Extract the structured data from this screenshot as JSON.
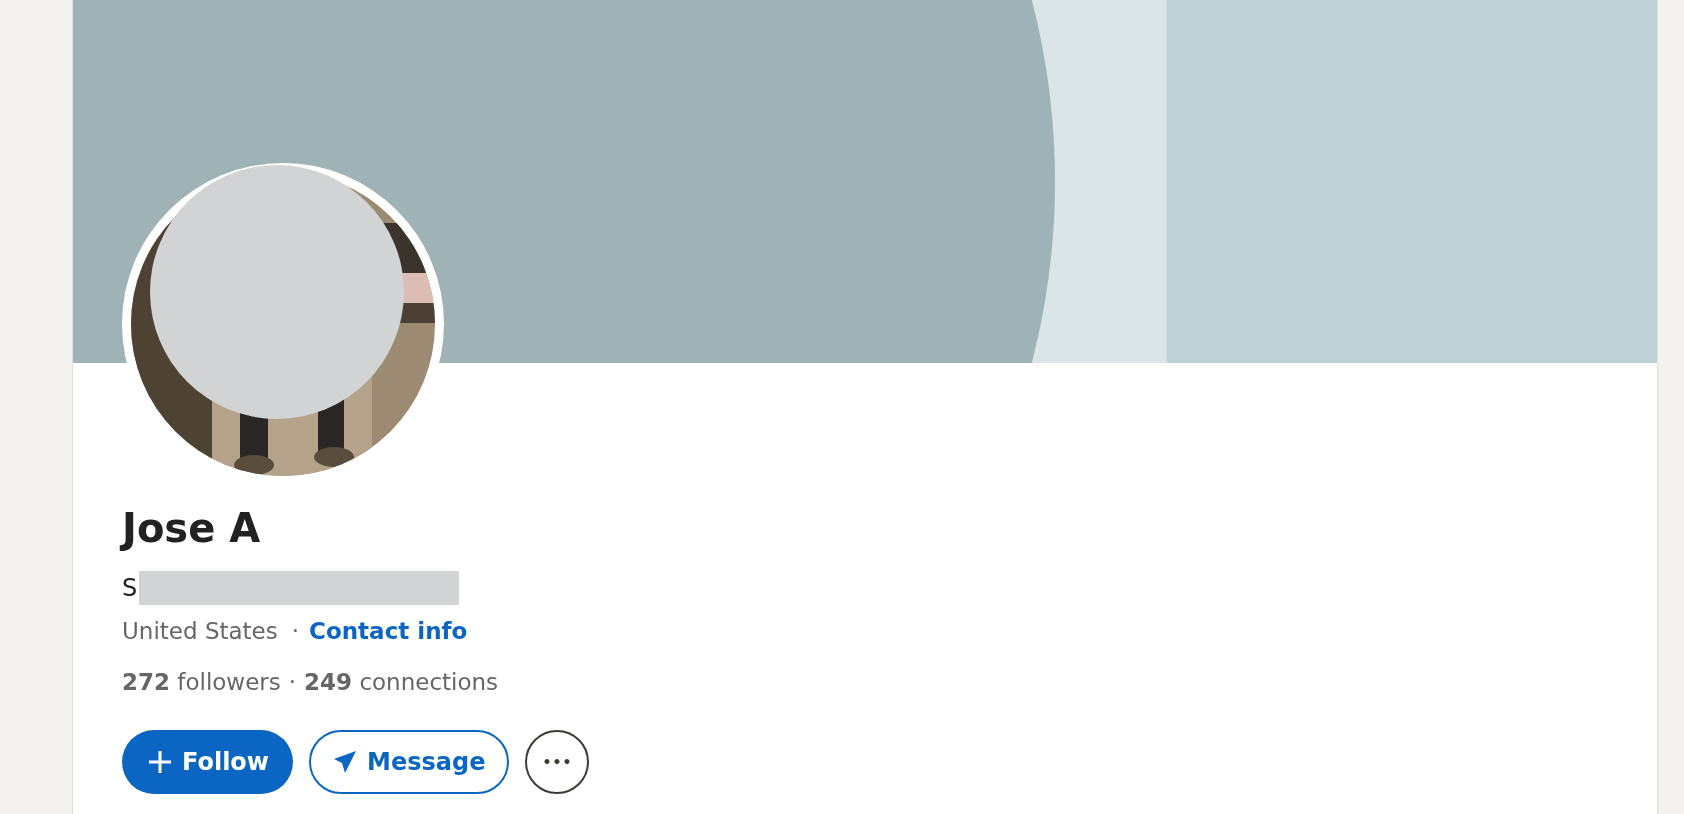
{
  "profile": {
    "name": "Jose A",
    "headline": "S",
    "location": "United States",
    "separator": "·",
    "contact_link": "Contact info",
    "followers_count": "272",
    "followers_label": "followers",
    "connections_count": "249",
    "connections_label": "connections"
  },
  "buttons": [
    {
      "kind": "primary",
      "label": "Follow"
    },
    {
      "kind": "outline",
      "label": "Message"
    },
    {
      "kind": "more",
      "label": "•••"
    }
  ]
}
